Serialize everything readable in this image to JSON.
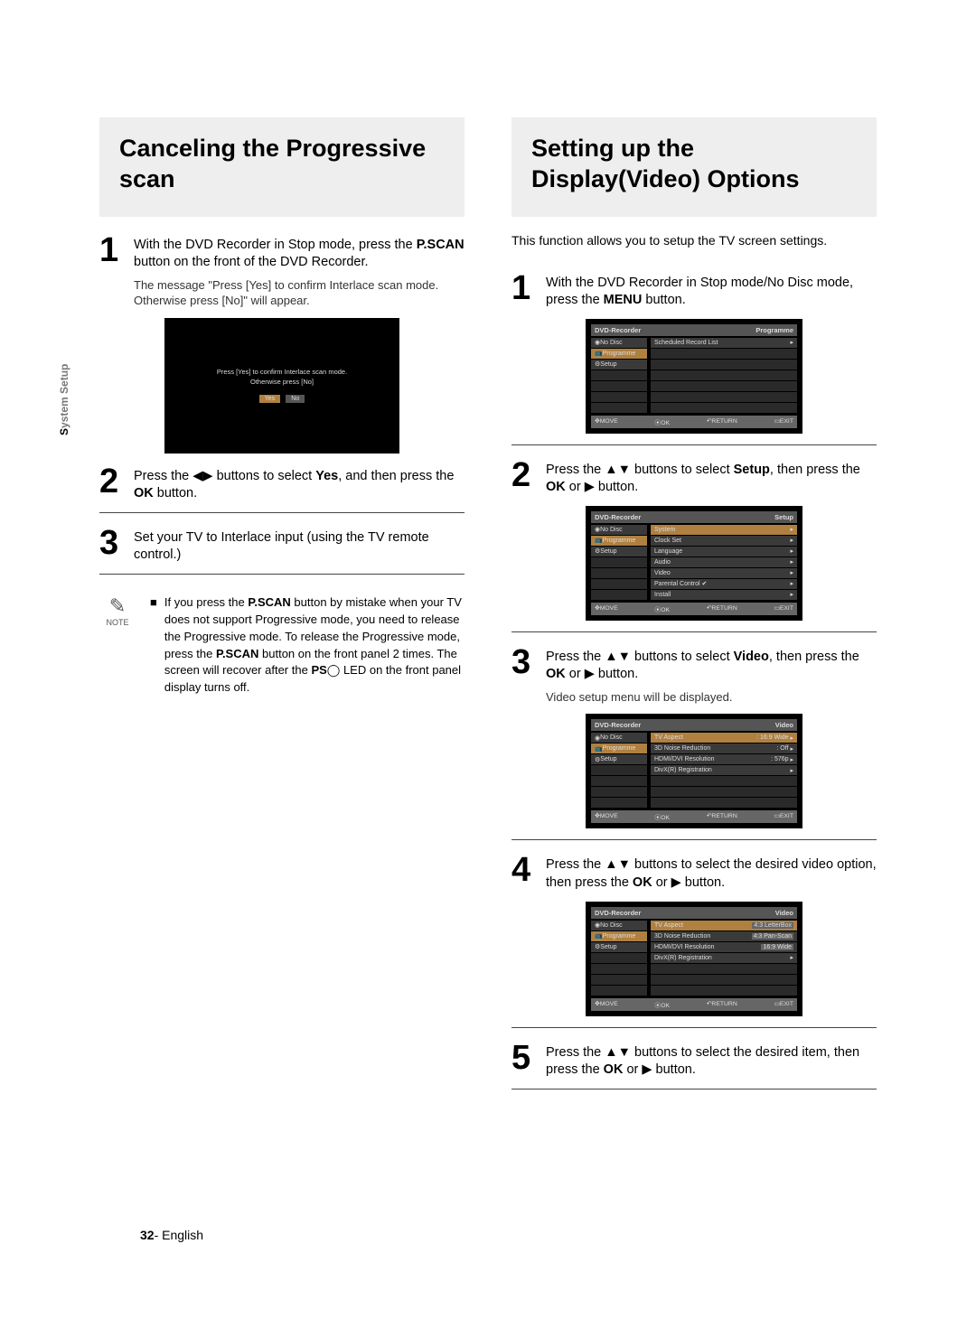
{
  "sidebar": {
    "prefix": "S",
    "rest": "ystem Setup"
  },
  "left": {
    "title": "Canceling the Progressive scan",
    "steps": [
      {
        "n": "1",
        "html": "With the DVD Recorder in Stop mode, press the <b>P.SCAN</b> button on the front of the DVD Recorder.",
        "sub": "The message \"Press [Yes] to confirm Interlace scan mode. Otherwise press [No]\" will appear."
      },
      {
        "n": "2",
        "html": "Press the ◀▶ buttons to select <b>Yes</b>, and then press the <b>OK</b> button."
      },
      {
        "n": "3",
        "html": "Set your TV to Interlace input (using the TV remote control.)"
      }
    ],
    "note_label": "NOTE",
    "note": "If you press the <b>P.SCAN</b> button by mistake when your TV does not support Progressive mode, you need to release the Progressive mode. To release the Progressive mode, press the <b>P.SCAN</b> button on the front panel 2 times. The screen will recover after the <b>PS</b>◯ LED on the front panel display turns off.",
    "dlg": {
      "line1": "Press [Yes] to confirm Interlace scan mode.",
      "line2": "Otherwise press [No]",
      "yes": "Yes",
      "no": "No"
    }
  },
  "right": {
    "title": "Setting up the Display(Video) Options",
    "intro": "This function allows you to setup the TV screen settings.",
    "steps": [
      {
        "n": "1",
        "html": "With the DVD Recorder in Stop mode/No Disc mode, press the <b>MENU</b> button."
      },
      {
        "n": "2",
        "html": "Press the ▲▼ buttons to select <b>Setup</b>, then press the <b>OK</b> or ▶ button."
      },
      {
        "n": "3",
        "html": "Press the ▲▼ buttons to select <b>Video</b>, then press the <b>OK</b> or ▶ button.",
        "sub": "Video setup menu will be displayed."
      },
      {
        "n": "4",
        "html": "Press the ▲▼ buttons to select the desired video option, then press the <b>OK</b> or ▶ button."
      },
      {
        "n": "5",
        "html": "Press the ▲▼ buttons to select the desired item, then press the <b>OK</b> or ▶ button."
      }
    ],
    "ui": {
      "brand": "DVD-Recorder",
      "nodisc": "No Disc",
      "programme": "Programme",
      "setup": "Setup",
      "video": "Video",
      "scheduled": "Scheduled Record List",
      "system": "System",
      "clock": "Clock Set",
      "language": "Language",
      "audio": "Audio",
      "video_opt": "Video",
      "parental": "Parental Control ✔",
      "install": "Install",
      "tvaspect": "TV Aspect",
      "tvaspect_v": ": 16:9 Wide",
      "nr": "3D Noise Reduction",
      "nr_v": ": Off",
      "hdmi": "HDMI/DVI Resolution",
      "hdmi_v": ": 576p",
      "divx": "DivX(R) Registration",
      "opt_43l": "4:3 LetterBox",
      "opt_43p": "4:3 Pan-Scan",
      "opt_169": "16:9 Wide",
      "move": "MOVE",
      "ok": "OK",
      "return": "RETURN",
      "exit": "EXIT"
    }
  },
  "footer": {
    "page": "32",
    "lang": "English"
  }
}
